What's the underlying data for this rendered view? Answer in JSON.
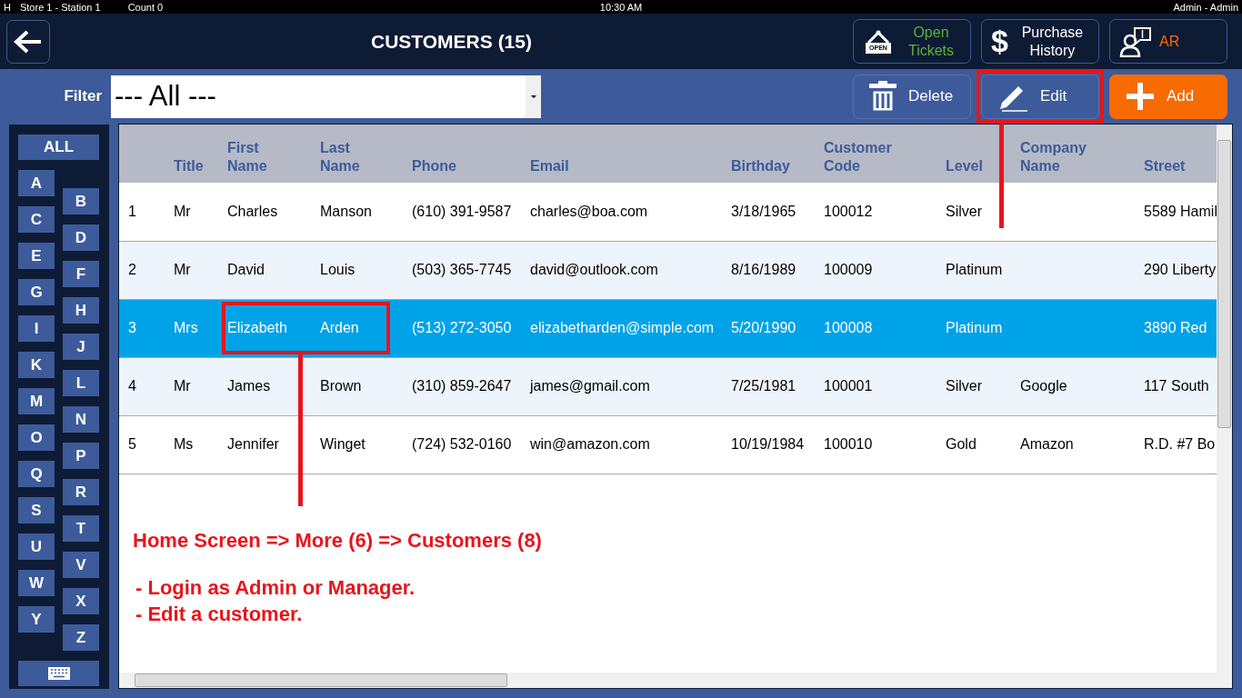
{
  "status_bar": {
    "left": [
      "H",
      "Store 1 - Station 1",
      "Count 0"
    ],
    "time": "10:30 AM",
    "user": "Admin - Admin"
  },
  "header": {
    "title": "CUSTOMERS (15)",
    "buttons": [
      {
        "kind": "open",
        "sign_text": "OPEN",
        "label_lines": [
          "Open",
          "Tickets"
        ]
      },
      {
        "kind": "dollar",
        "icon_char": "$",
        "label_lines": [
          "Purchase",
          "History"
        ]
      },
      {
        "kind": "ar",
        "label_lines": [
          "AR"
        ]
      }
    ]
  },
  "filter": {
    "label": "Filter",
    "value": "--- All ---"
  },
  "actions": [
    {
      "kind": "delete",
      "label": "Delete",
      "highlighted": false
    },
    {
      "kind": "edit",
      "label": "Edit",
      "highlighted": true
    },
    {
      "kind": "add",
      "label": "Add",
      "highlighted": false
    }
  ],
  "alphabet": {
    "all": "ALL",
    "letters": [
      "A",
      "B",
      "C",
      "D",
      "E",
      "F",
      "G",
      "H",
      "I",
      "J",
      "K",
      "L",
      "M",
      "N",
      "O",
      "P",
      "Q",
      "R",
      "S",
      "T",
      "U",
      "V",
      "W",
      "X",
      "Y",
      "Z"
    ]
  },
  "table": {
    "columns": [
      "",
      "Title",
      "First Name",
      "Last Name",
      "Phone",
      "Email",
      "Birthday",
      "Customer Code",
      "Level",
      "Company Name",
      "Street"
    ],
    "rows": [
      {
        "selected": false,
        "names_highlighted": false,
        "cells": [
          "1",
          "Mr",
          "Charles",
          "Manson",
          "(610) 391-9587",
          "charles@boa.com",
          "3/18/1965",
          "100012",
          "Silver",
          "",
          "5589 Hamil"
        ]
      },
      {
        "selected": false,
        "names_highlighted": false,
        "cells": [
          "2",
          "Mr",
          "David",
          "Louis",
          "(503) 365-7745",
          "david@outlook.com",
          "8/16/1989",
          "100009",
          "Platinum",
          "",
          "290 Liberty"
        ]
      },
      {
        "selected": true,
        "names_highlighted": true,
        "cells": [
          "3",
          "Mrs",
          "Elizabeth",
          "Arden",
          "(513) 272-3050",
          "elizabetharden@simple.com",
          "5/20/1990",
          "100008",
          "Platinum",
          "",
          "3890 Red"
        ]
      },
      {
        "selected": false,
        "names_highlighted": false,
        "cells": [
          "4",
          "Mr",
          "James",
          "Brown",
          "(310) 859-2647",
          "james@gmail.com",
          "7/25/1981",
          "100001",
          "Silver",
          "Google",
          "117 South"
        ]
      },
      {
        "selected": false,
        "names_highlighted": false,
        "cells": [
          "5",
          "Ms",
          "Jennifer",
          "Winget",
          "(724) 532-0160",
          "win@amazon.com",
          "10/19/1984",
          "100010",
          "Gold",
          "Amazon",
          "R.D. #7 Bo"
        ]
      }
    ]
  },
  "annotation": {
    "path": "Home Screen => More (6) => Customers (8)",
    "steps": [
      "- Login as Admin or Manager.",
      "- Edit a customer."
    ]
  }
}
